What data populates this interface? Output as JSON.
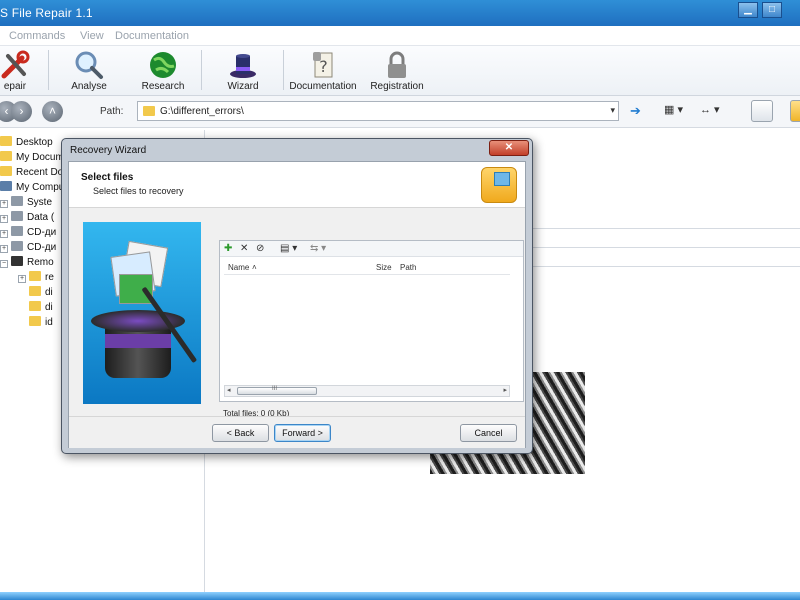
{
  "window": {
    "title": "S File Repair 1.1",
    "minimize_glyph": "▁",
    "maximize_glyph": "□"
  },
  "menu": [
    "Commands",
    "View",
    "Documentation"
  ],
  "toolbar": {
    "repair": "epair",
    "analyse": "Analyse",
    "research": "Research",
    "wizard": "Wizard",
    "documentation": "Documentation",
    "registration": "Registration"
  },
  "pathbar": {
    "label": "Path:",
    "value": "G:\\different_errors\\",
    "dropdown_glyph": "▾",
    "go_glyph": "➔",
    "view_glyph": "▦ ▾",
    "sort_glyph": "↔ ▾"
  },
  "tree": [
    {
      "label": "Desktop",
      "type": "folder"
    },
    {
      "label": "My Docum",
      "type": "folder"
    },
    {
      "label": "Recent Do",
      "type": "folder"
    },
    {
      "label": "My Compu",
      "type": "pc"
    },
    {
      "label": "Syste",
      "type": "drive"
    },
    {
      "label": "Data (",
      "type": "drive"
    },
    {
      "label": "CD-ди",
      "type": "drive"
    },
    {
      "label": "CD-ди",
      "type": "drive"
    },
    {
      "label": "Remo",
      "type": "drive"
    },
    {
      "label": "re",
      "type": "folder"
    },
    {
      "label": "di",
      "type": "folder"
    },
    {
      "label": "di",
      "type": "folder"
    },
    {
      "label": "id",
      "type": "folder"
    }
  ],
  "dialog": {
    "title": "Recovery Wizard",
    "close_glyph": "✕",
    "heading": "Select files",
    "subheading": "Select files to recovery",
    "list_toolbar": [
      "✚",
      "✕",
      "⊘",
      "▤ ▾",
      "⇆ ▾"
    ],
    "columns": {
      "name": "Name",
      "size": "Size",
      "path": "Path"
    },
    "name_sort_glyph": "˄",
    "scroll_left": "◂",
    "scroll_right": "▸",
    "scroll_thumb": "III",
    "total_files": "Total files: 0 (0 Kb)",
    "back_button": "< Back",
    "forward_button": "Forward >",
    "cancel_button": "Cancel"
  },
  "colors": {
    "title_bar": "#1f6fc0",
    "wizard_image_bg": "#1a9be0",
    "dialog_frame": "#c4ccd6"
  }
}
